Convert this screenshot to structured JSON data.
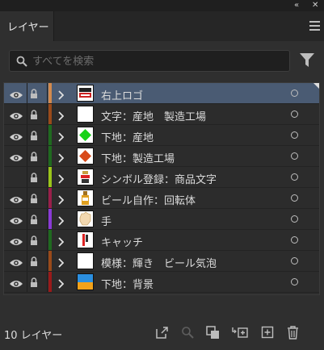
{
  "panel": {
    "title_controls": "«",
    "close_control": "✕",
    "tab_label": "レイヤー",
    "search_placeholder": "すべてを検索",
    "footer_count": "10 レイヤー"
  },
  "layers": [
    {
      "name": "右上ロゴ",
      "visible": true,
      "color": "#d28a4e",
      "selected": true,
      "thumb": "logo"
    },
    {
      "name": "文字：産地　製造工場",
      "visible": true,
      "color": "#9a4a1a",
      "selected": false,
      "thumb": "blank"
    },
    {
      "name": "下地：産地",
      "visible": true,
      "color": "#1f6a1f",
      "selected": false,
      "thumb": "green-diamond"
    },
    {
      "name": "下地：製造工場",
      "visible": true,
      "color": "#1f6a1f",
      "selected": false,
      "thumb": "red-diamond"
    },
    {
      "name": "シンボル登録：商品文字",
      "visible": false,
      "color": "#9ac41a",
      "selected": false,
      "thumb": "product"
    },
    {
      "name": "ビール自作：回転体",
      "visible": true,
      "color": "#9a1f4a",
      "selected": false,
      "thumb": "beer"
    },
    {
      "name": "手",
      "visible": true,
      "color": "#8a3ad6",
      "selected": false,
      "thumb": "hand"
    },
    {
      "name": "キャッチ",
      "visible": true,
      "color": "#1f6a1f",
      "selected": false,
      "thumb": "catch"
    },
    {
      "name": "模様：輝き　ビール気泡",
      "visible": true,
      "color": "#9a4a1a",
      "selected": false,
      "thumb": "blank"
    },
    {
      "name": "下地：背景",
      "visible": true,
      "color": "#9a1a1a",
      "selected": false,
      "thumb": "bg"
    }
  ]
}
